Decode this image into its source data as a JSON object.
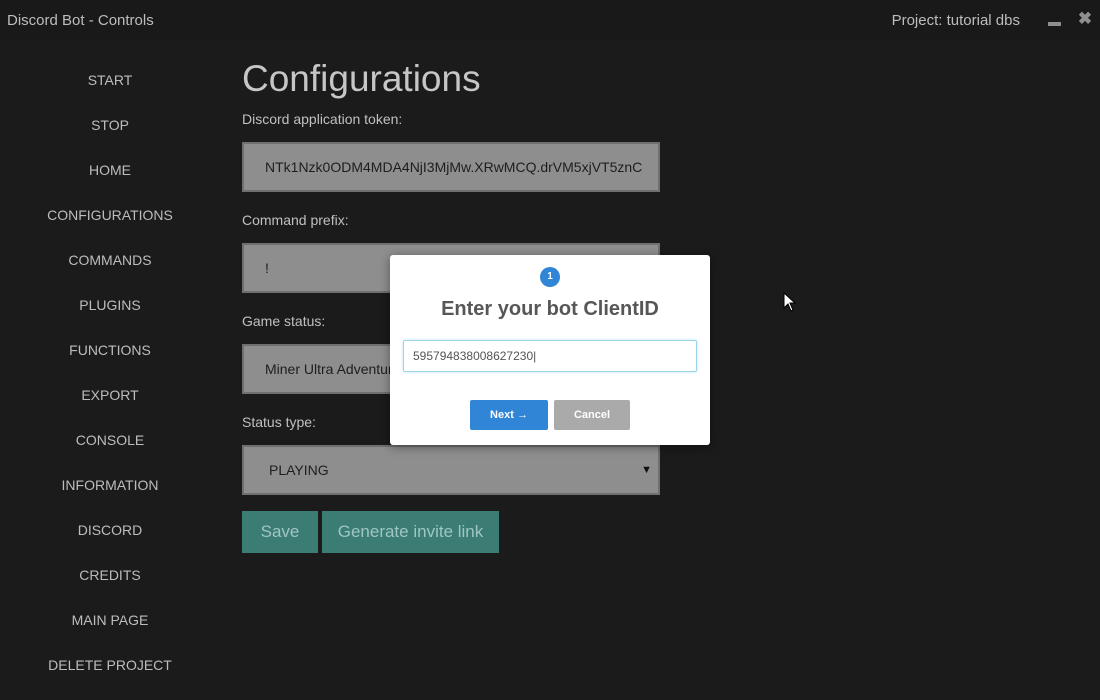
{
  "window": {
    "title": "Discord Bot - Controls",
    "project": "Project: tutorial dbs"
  },
  "sidebar": {
    "items": [
      {
        "label": "START"
      },
      {
        "label": "STOP"
      },
      {
        "label": "HOME"
      },
      {
        "label": "CONFIGURATIONS"
      },
      {
        "label": "COMMANDS"
      },
      {
        "label": "PLUGINS"
      },
      {
        "label": "FUNCTIONS"
      },
      {
        "label": "EXPORT"
      },
      {
        "label": "CONSOLE"
      },
      {
        "label": "INFORMATION"
      },
      {
        "label": "DISCORD"
      },
      {
        "label": "CREDITS"
      },
      {
        "label": "MAIN PAGE"
      },
      {
        "label": "DELETE PROJECT"
      }
    ]
  },
  "main": {
    "title": "Configurations",
    "token_label": "Discord application token:",
    "token_value": "NTk1Nzk0ODM4MDA4NjI3MjMw.XRwMCQ.drVM5xjVT5znC",
    "prefix_label": "Command prefix:",
    "prefix_value": "!",
    "game_label": "Game status:",
    "game_value": "Miner Ultra Adventures",
    "status_label": "Status type:",
    "status_value": "PLAYING",
    "save_label": "Save",
    "invite_label": "Generate invite link"
  },
  "dialog": {
    "step": "1",
    "title": "Enter your bot ClientID",
    "input_value": "595794838008627230|",
    "next_label": "Next →",
    "cancel_label": "Cancel"
  },
  "colors": {
    "background": "#1b1b1b",
    "accent_teal": "#3b7c75",
    "dialog_primary": "#3085d6"
  }
}
